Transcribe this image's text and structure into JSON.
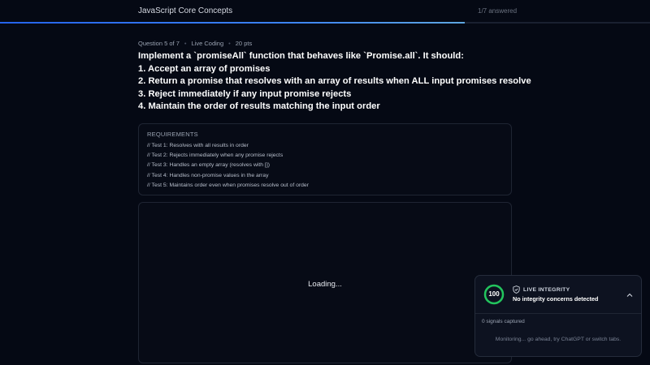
{
  "header": {
    "title": "JavaScript Core Concepts",
    "progress_text": "1/7 answered",
    "progress_fraction": 0.715
  },
  "question": {
    "meta": {
      "number": "Question 5 of 7",
      "type": "Live Coding",
      "points": "20 pts"
    },
    "lines": [
      "Implement a `promiseAll` function that behaves like `Promise.all`. It should:",
      "1. Accept an array of promises",
      "2. Return a promise that resolves with an array of results when ALL input promises resolve",
      "3. Reject immediately if any input promise rejects",
      "4. Maintain the order of results matching the input order"
    ]
  },
  "requirements": {
    "title": "REQUIREMENTS",
    "tests": [
      "// Test 1: Resolves with all results in order",
      "// Test 2: Rejects immediately when any promise rejects",
      "// Test 3: Handles an empty array (resolves with [])",
      "// Test 4: Handles non-promise values in the array",
      "// Test 5: Maintains order even when promises resolve out of order"
    ]
  },
  "editor": {
    "loading_text": "Loading..."
  },
  "integrity": {
    "score": "100",
    "label": "LIVE INTEGRITY",
    "status": "No integrity concerns detected",
    "signals": "0 signals captured",
    "monitoring": "Monitoring... go ahead, try ChatGPT or switch tabs.",
    "ring_color": "#22c55e",
    "icons": {
      "shield": "shield-icon",
      "collapse": "chevron-up-icon"
    }
  }
}
